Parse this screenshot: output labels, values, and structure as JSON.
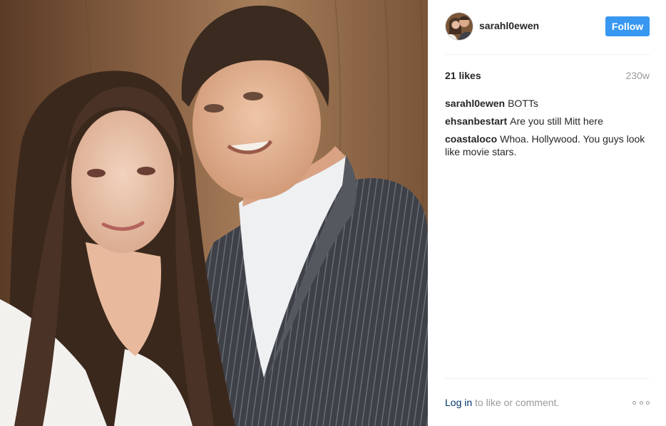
{
  "post": {
    "username": "sarahl0ewen",
    "follow_label": "Follow",
    "likes": "21 likes",
    "time_ago": "230w",
    "comments": [
      {
        "author": "sarahl0ewen",
        "text": "BOTTs"
      },
      {
        "author": "ehsanbestart",
        "text": "Are you still Mitt here"
      },
      {
        "author": "coastaloco",
        "text": "Whoa. Hollywood. You guys look like movie stars."
      }
    ],
    "footer": {
      "login_link": "Log in",
      "login_rest": " to like or comment."
    }
  },
  "colors": {
    "follow_button": "#3897f0",
    "link": "#003569",
    "muted": "#999999",
    "divider": "#efefef"
  },
  "icons": {
    "more": "more-options-icon"
  }
}
